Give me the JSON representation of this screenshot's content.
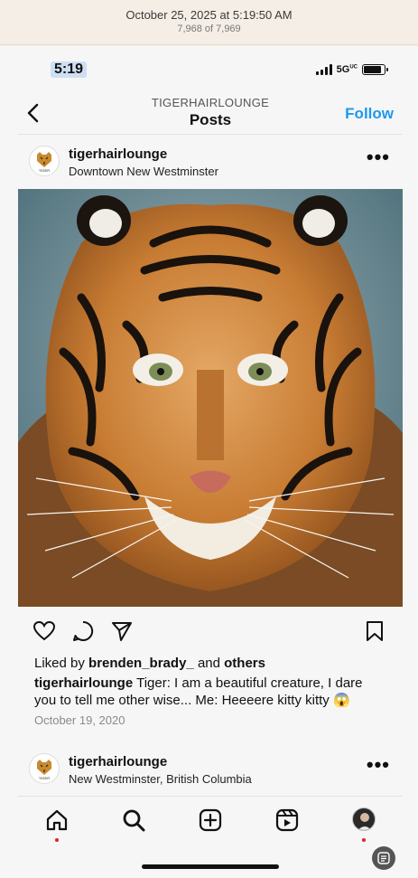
{
  "viewer": {
    "date": "October 25, 2025 at 5:19:50 AM",
    "count": "7,968 of 7,969"
  },
  "status": {
    "time": "5:19",
    "network": "5G",
    "network_suffix": "UC"
  },
  "nav": {
    "subtitle": "TIGERHAIRLOUNGE",
    "title": "Posts",
    "follow_label": "Follow"
  },
  "post": {
    "username": "tigerhairlounge",
    "location": "Downtown New Westminster",
    "liked_by_prefix": "Liked by",
    "liked_by_user": "brenden_brady_",
    "liked_by_and": "and",
    "liked_by_others": "others",
    "caption_user": "tigerhairlounge",
    "caption_text": "Tiger: I am a beautiful creature, I dare you to tell me other wise... Me: Heeeere kitty kitty 😱",
    "date": "October 19, 2020"
  },
  "next_post": {
    "username": "tigerhairlounge",
    "location": "New Westminster, British Columbia"
  },
  "logo_text": "TIGER",
  "colors": {
    "follow": "#1d98f0",
    "notification_dot": "#e0202c",
    "selection_highlight": "#cfdff3"
  }
}
